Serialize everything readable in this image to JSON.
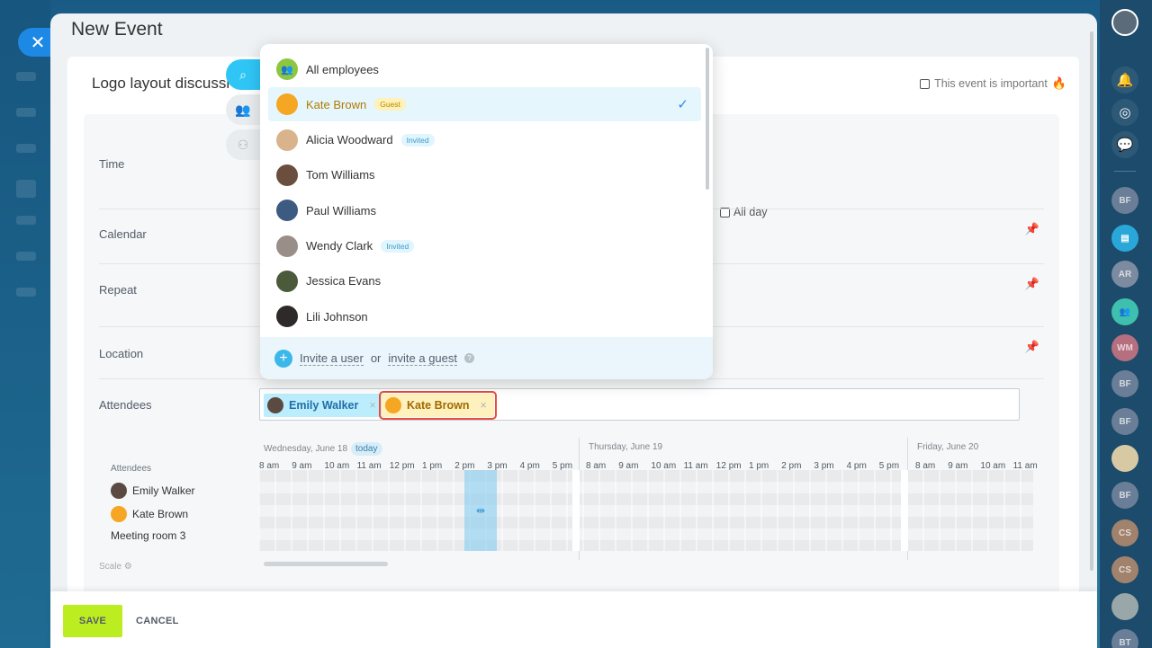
{
  "panel": {
    "title": "New Event"
  },
  "event": {
    "name": "Logo layout discussi",
    "important_label": "This event is important"
  },
  "form": {
    "time_label": "Time",
    "all_day_label": "All day",
    "calendar_label": "Calendar",
    "repeat_label": "Repeat",
    "location_label": "Location",
    "attendees_label": "Attendees",
    "scale_label": "Scale"
  },
  "attendees_chips": [
    {
      "name": "Emily Walker"
    },
    {
      "name": "Kate Brown"
    }
  ],
  "dropdown": {
    "items": [
      {
        "name": "All employees",
        "badge": ""
      },
      {
        "name": "Kate Brown",
        "badge": "Guest",
        "selected": true
      },
      {
        "name": "Alicia Woodward",
        "badge": "Invited"
      },
      {
        "name": "Tom Williams",
        "badge": ""
      },
      {
        "name": "Paul Williams",
        "badge": ""
      },
      {
        "name": "Wendy Clark",
        "badge": "Invited"
      },
      {
        "name": "Jessica Evans",
        "badge": ""
      },
      {
        "name": "Lili Johnson",
        "badge": ""
      }
    ],
    "footer": {
      "invite_user": "Invite a user",
      "or": "or",
      "invite_guest": "invite a guest"
    }
  },
  "planner": {
    "days": [
      "Wednesday, June 18",
      "Thursday, June 19",
      "Friday, June 20"
    ],
    "today_badge": "today",
    "hours_day1": [
      "8 am",
      "9 am",
      "10 am",
      "11 am",
      "12 pm",
      "1 pm",
      "2 pm",
      "3 pm",
      "4 pm",
      "5 pm"
    ],
    "hours_day2": [
      "8 am",
      "9 am",
      "10 am",
      "11 am",
      "12 pm",
      "1 pm",
      "2 pm",
      "3 pm",
      "4 pm",
      "5 pm"
    ],
    "hours_day3": [
      "8 am",
      "9 am",
      "10 am",
      "11 am"
    ],
    "attendees_title": "Attendees",
    "people": [
      "Emily Walker",
      "Kate Brown",
      "Meeting room 3"
    ]
  },
  "footer": {
    "save": "SAVE",
    "cancel": "CANCEL"
  },
  "rail": {
    "avatars": [
      "BF",
      "AR",
      "WM",
      "BF",
      "BF",
      "BF",
      "CS",
      "CS",
      "BT"
    ]
  },
  "colors": {
    "save": "#bbed21",
    "guest": "#f5a623",
    "highlight": "#e74c3c",
    "accent": "#3bb7ea"
  }
}
